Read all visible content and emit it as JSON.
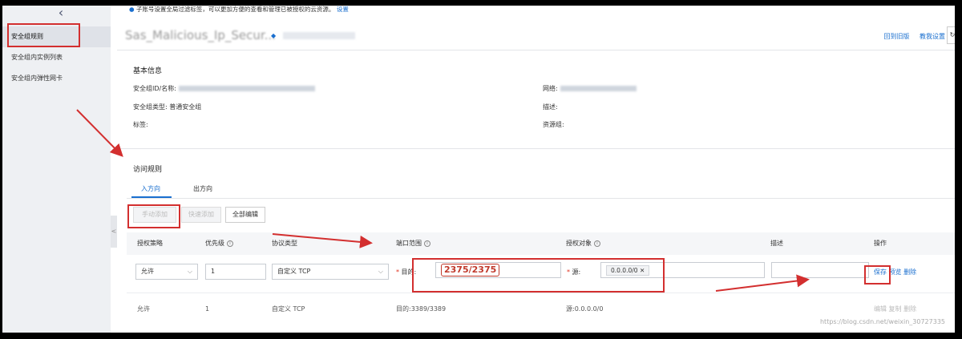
{
  "notice": {
    "text": "子账号设置全局过滤标签，可以更加方便的查看和管理已被授权的云资源。",
    "link": "设置"
  },
  "sidebar": {
    "items": [
      {
        "label": "安全组规则",
        "active": true
      },
      {
        "label": "安全组内实例列表",
        "active": false
      },
      {
        "label": "安全组内弹性网卡",
        "active": false
      }
    ],
    "collapse_glyph": "<"
  },
  "header": {
    "title": "Sas_Malicious_Ip_Secur...",
    "back_to_old": "回到旧版",
    "tutorial": "教我设置"
  },
  "basic_info": {
    "heading": "基本信息",
    "id_name_label": "安全组ID/名称:",
    "type_label": "安全组类型:",
    "type_value": "普通安全组",
    "tags_label": "标签:",
    "network_label": "网络:",
    "desc_label": "描述:",
    "resource_group_label": "资源组:"
  },
  "access_rules": {
    "heading": "访问规则",
    "tabs": [
      {
        "label": "入方向",
        "active": true
      },
      {
        "label": "出方向",
        "active": false
      }
    ],
    "buttons": {
      "manual_add": "手动添加",
      "quick_add": "快速添加",
      "edit_all": "全部编辑"
    },
    "columns": [
      "授权策略",
      "优先级",
      "协议类型",
      "端口范围",
      "授权对象",
      "描述",
      "操作"
    ],
    "edit_row": {
      "policy": "允许",
      "priority": "1",
      "protocol": "自定义 TCP",
      "port_label": "目的:",
      "port_value": "2375/2375",
      "source_label": "源:",
      "source_value": "0.0.0.0/0",
      "ops": [
        "保存",
        "预览",
        "删除"
      ]
    },
    "rows": [
      {
        "policy": "允许",
        "priority": "1",
        "protocol": "自定义 TCP",
        "port": "目的:3389/3389",
        "source": "源:0.0.0.0/0",
        "ops": [
          "编辑",
          "复制",
          "删除"
        ]
      }
    ]
  },
  "colors": {
    "accent": "#1a6fcf",
    "annotation": "#d32f2f"
  },
  "watermark": "https://blog.csdn.net/weixin_30727335"
}
